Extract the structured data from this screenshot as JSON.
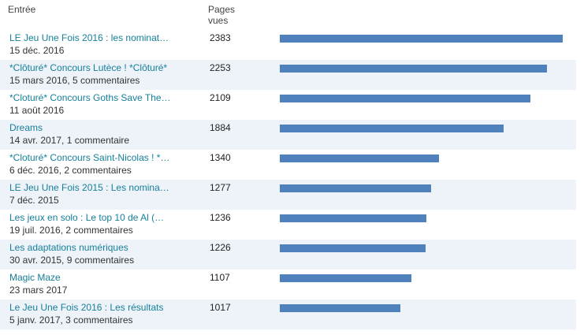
{
  "header": {
    "entry_label": "Entrée",
    "views_label": "Pages vues"
  },
  "accent_color": "#4f81bd",
  "link_color": "#16809a",
  "max_views": 2383,
  "rows": [
    {
      "title": "LE Jeu Une Fois 2016 : les nominat…",
      "meta": "15 déc. 2016",
      "views": 2383
    },
    {
      "title": "*Clôturé* Concours Lutèce ! *Clôturé*",
      "meta": "15 mars 2016, 5 commentaires",
      "views": 2253
    },
    {
      "title": "*Cloturé* Concours Goths Save The…",
      "meta": "11 août 2016",
      "views": 2109
    },
    {
      "title": "Dreams",
      "meta": "14 avr. 2017, 1 commentaire",
      "views": 1884
    },
    {
      "title": "*Cloturé* Concours Saint-Nicolas ! *…",
      "meta": "6 déc. 2016, 2 commentaires",
      "views": 1340
    },
    {
      "title": "LE Jeu Une Fois 2015 : Les nomina…",
      "meta": "7 déc. 2015",
      "views": 1277
    },
    {
      "title": "Les jeux en solo : Le top 10 de Al (…",
      "meta": "19 juil. 2016, 2 commentaires",
      "views": 1236
    },
    {
      "title": "Les adaptations numériques",
      "meta": "30 avr. 2015, 9 commentaires",
      "views": 1226
    },
    {
      "title": "Magic Maze",
      "meta": "23 mars 2017",
      "views": 1107
    },
    {
      "title": "Le Jeu Une Fois 2016 : Les résultats",
      "meta": "5 janv. 2017, 3 commentaires",
      "views": 1017
    }
  ]
}
